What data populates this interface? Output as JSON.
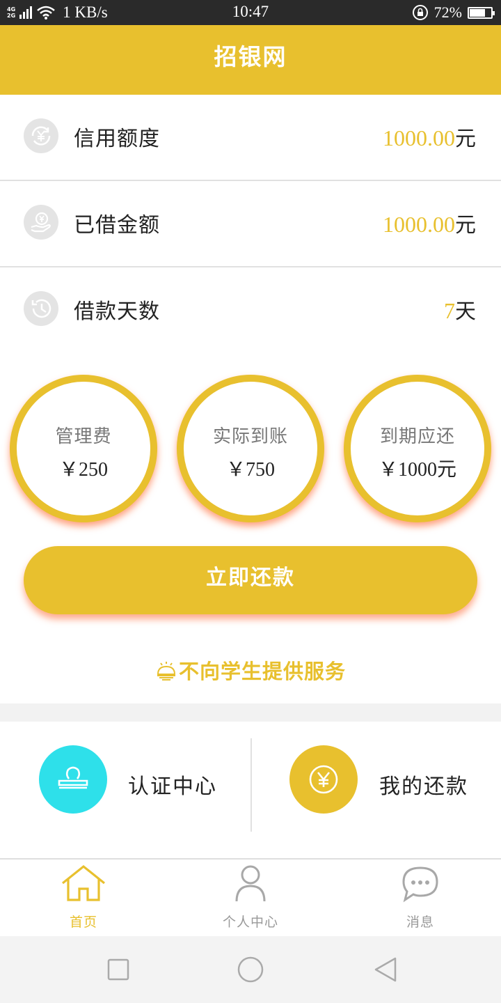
{
  "status_bar": {
    "network_top": "4G",
    "network_bottom": "2G",
    "speed": "1 KB/s",
    "time": "10:47",
    "battery_percent": "72%",
    "battery_level": 0.72
  },
  "header": {
    "title": "招银网"
  },
  "info_rows": [
    {
      "label": "信用额度",
      "value": "1000.00",
      "unit": "元",
      "icon": "yen-refresh-icon"
    },
    {
      "label": "已借金额",
      "value": "1000.00",
      "unit": "元",
      "icon": "yen-hand-icon"
    },
    {
      "label": "借款天数",
      "value": "7",
      "unit": "天",
      "icon": "history-clock-icon"
    }
  ],
  "circles": [
    {
      "label": "管理费",
      "amount": "￥250"
    },
    {
      "label": "实际到账",
      "amount": "￥750"
    },
    {
      "label": "到期应还",
      "amount": "￥1000元"
    }
  ],
  "repay_button": {
    "label": "立即还款"
  },
  "notice": {
    "text": "不向学生提供服务",
    "icon": "bell-icon"
  },
  "quick_actions": [
    {
      "label": "认证中心",
      "icon": "stamp-icon",
      "color": "#2ee0ea"
    },
    {
      "label": "我的还款",
      "icon": "yen-coin-icon",
      "color": "#e8c02e"
    }
  ],
  "tabs": [
    {
      "label": "首页",
      "icon": "home-icon",
      "active": true
    },
    {
      "label": "个人中心",
      "icon": "person-icon",
      "active": false
    },
    {
      "label": "消息",
      "icon": "chat-bubble-icon",
      "active": false
    }
  ],
  "colors": {
    "accent": "#e8c02e",
    "cyan": "#2ee0ea",
    "shadow": "#ff5a1e"
  }
}
